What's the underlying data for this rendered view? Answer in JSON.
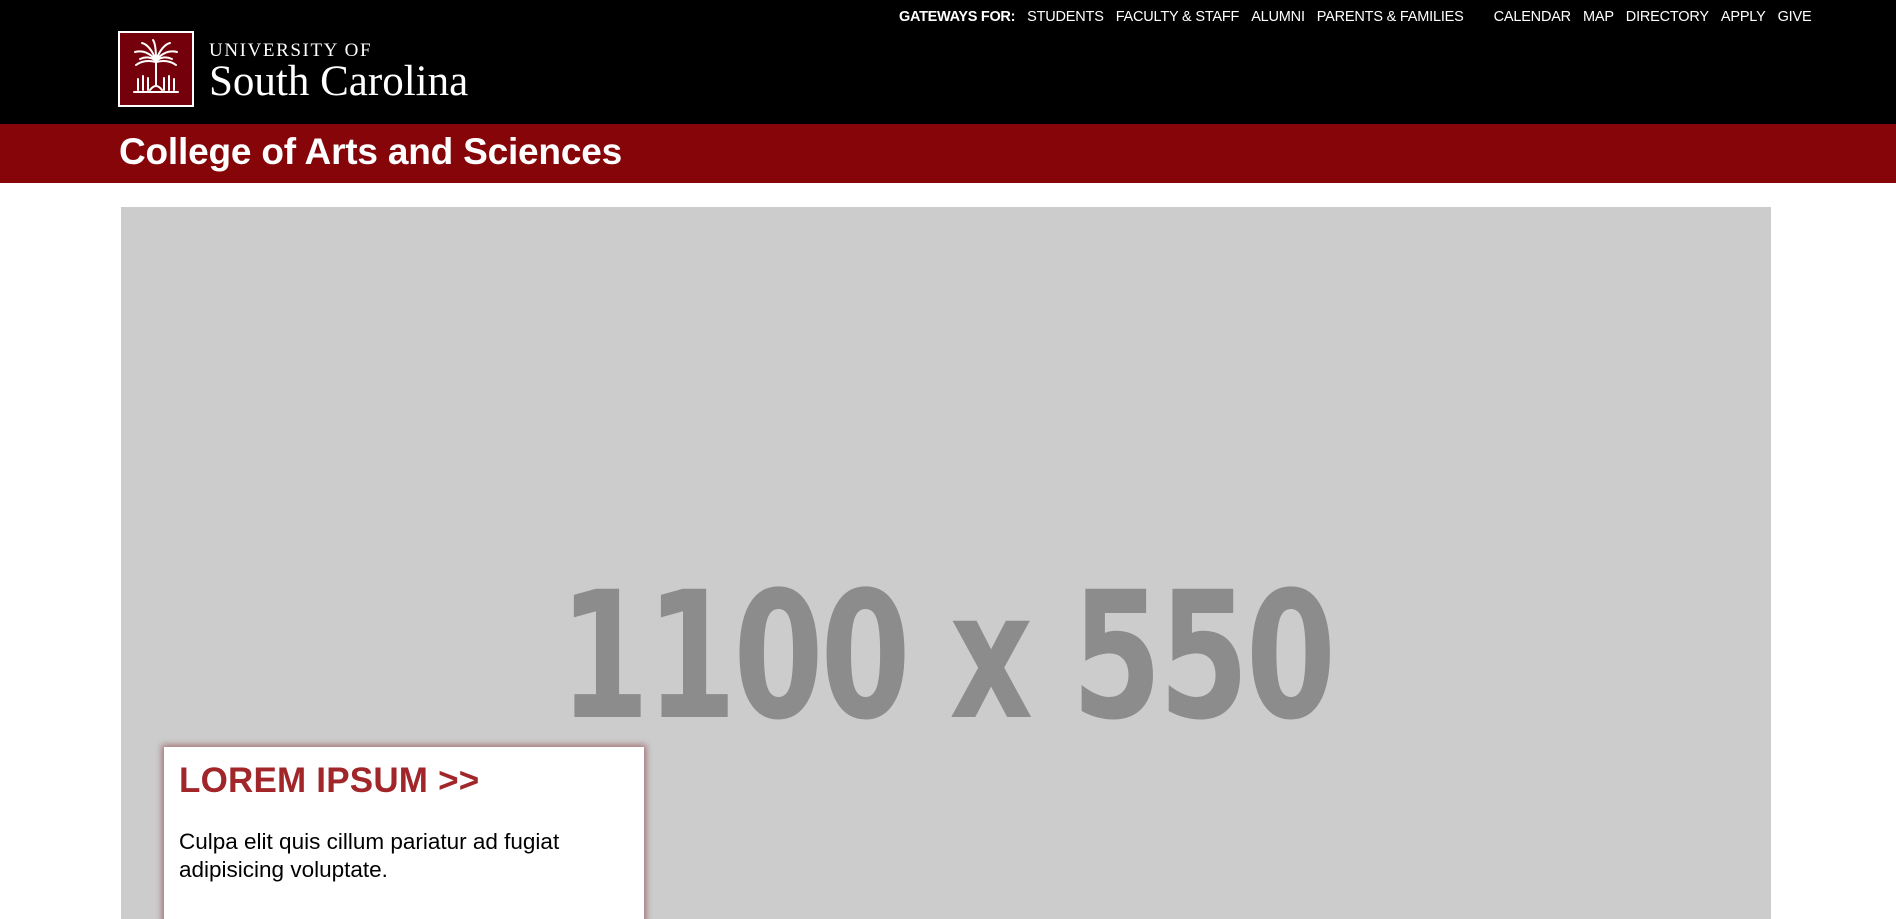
{
  "header": {
    "logo": {
      "line1": "UNIVERSITY OF",
      "line2": "South Carolina"
    },
    "gateways_label": "GATEWAYS FOR:",
    "gateways": [
      {
        "label": "STUDENTS"
      },
      {
        "label": "FACULTY & STAFF"
      },
      {
        "label": "ALUMNI"
      },
      {
        "label": "PARENTS & FAMILIES"
      }
    ],
    "utility_links": [
      {
        "label": "CALENDAR"
      },
      {
        "label": "MAP"
      },
      {
        "label": "DIRECTORY"
      },
      {
        "label": "APPLY"
      },
      {
        "label": "GIVE"
      }
    ]
  },
  "site_title": "College of Arts and Sciences",
  "hero": {
    "placeholder_text": "1100 x 550",
    "card": {
      "title": "LOREM IPSUM >>",
      "body": "Culpa elit quis cillum pariatur ad fugiat adipisicing voluptate."
    }
  },
  "colors": {
    "top_bar": "#000000",
    "brand_red": "#860509",
    "logo_garnet": "#73000a",
    "card_title": "#a0262a",
    "hero_placeholder_bg": "#cccccc",
    "hero_placeholder_text": "#8c8c8c"
  },
  "icons": {
    "logo_mark": "palmetto-tree-icon"
  }
}
